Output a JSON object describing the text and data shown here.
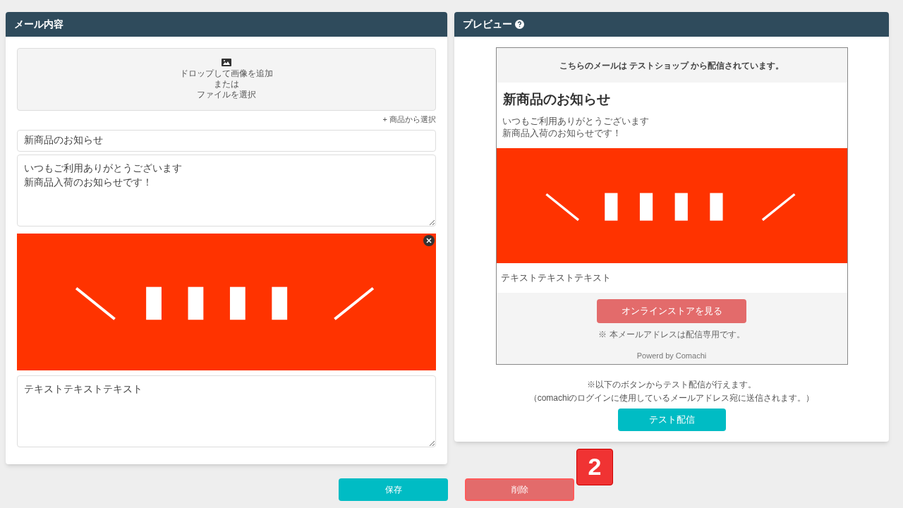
{
  "editor": {
    "title": "メール内容",
    "dropzone": {
      "lines": [
        "ドロップして画像を追加",
        "または",
        "ファイルを選択"
      ]
    },
    "product_link": "+ 商品から選択",
    "subject": "新商品のお知らせ",
    "body": [
      "いつもご利用ありがとうございます",
      "新商品入荷のお知らせです！"
    ],
    "image": {
      "kind": "picture"
    },
    "footer_text": "テキストテキストテキスト"
  },
  "preview": {
    "title": "プレビュー",
    "notice": "こちらのメールは テストショップ から配信されています。",
    "heading": "新商品のお知らせ",
    "body": [
      "いつもご利用ありがとうございます",
      "新商品入荷のお知らせです！"
    ],
    "image": {
      "kind": "picture"
    },
    "footer_text": "テキストテキストテキスト",
    "store_button": "オンラインストアを見る",
    "note": "※ 本メールアドレスは配信専用です。",
    "powered": "Powerd by Comachi",
    "test_note": "※以下のボタンからテスト配信が行えます。",
    "test_subnote": "（comachiのログインに使用しているメールアドレス宛に送信されます。）",
    "test_button": "テスト配信"
  },
  "buttons": [
    {
      "label": "保存",
      "kind": "primary"
    },
    {
      "label": "削除",
      "kind": "danger"
    }
  ],
  "step_badge": "2"
}
